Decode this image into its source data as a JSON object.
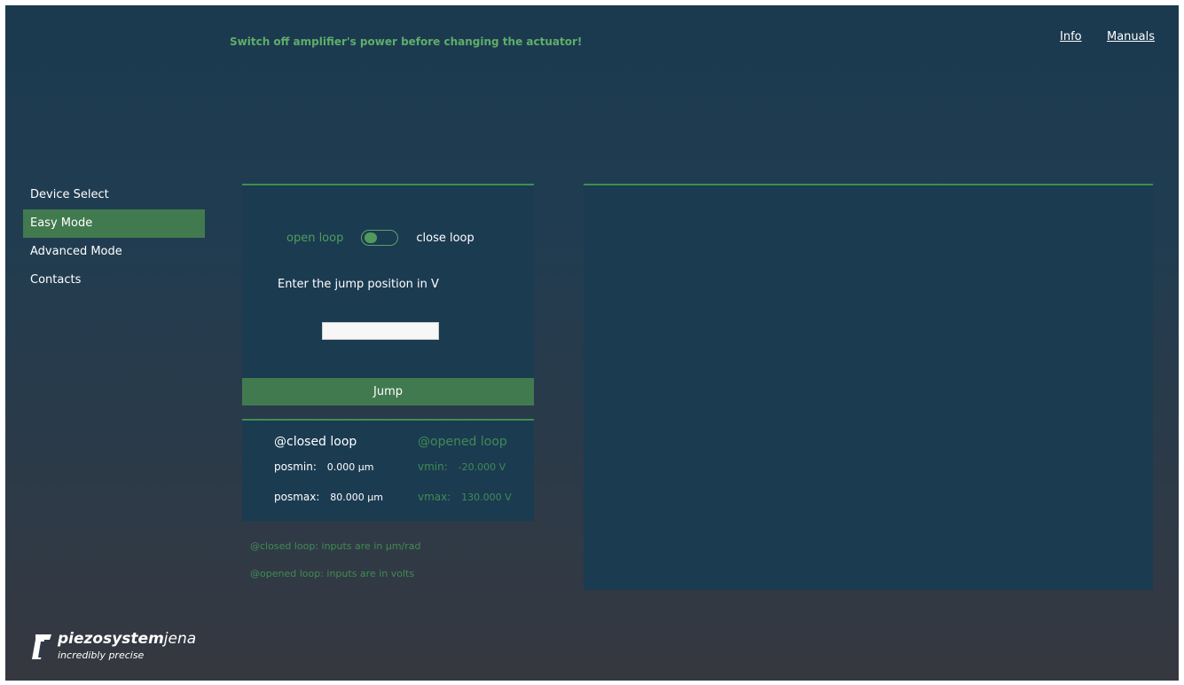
{
  "header": {
    "warning": "Switch off amplifier's power before changing the actuator!",
    "links": {
      "info": "Info",
      "manuals": "Manuals"
    }
  },
  "sidebar": {
    "items": [
      {
        "label": "Device Select"
      },
      {
        "label": "Easy Mode"
      },
      {
        "label": "Advanced Mode"
      },
      {
        "label": "Contacts"
      }
    ],
    "active": "Easy Mode"
  },
  "easy_mode": {
    "loop_toggle": {
      "left_label": "open loop",
      "right_label": "close loop",
      "state": "open loop"
    },
    "jump_prompt": "Enter the jump position in V",
    "jump_value": "",
    "jump_button": "Jump"
  },
  "limits": {
    "closed_header": "@closed loop",
    "opened_header": "@opened loop",
    "posmin": {
      "label": "posmin:",
      "value": "0.000 µm"
    },
    "posmax": {
      "label": "posmax:",
      "value": "80.000 µm"
    },
    "vmin": {
      "label": "vmin:",
      "value": "-20.000 V"
    },
    "vmax": {
      "label": "vmax:",
      "value": "130.000 V"
    }
  },
  "notes": {
    "closed": "@closed loop:  inputs are in µm/rad",
    "opened": "@opened loop:  inputs are in volts"
  },
  "logo": {
    "brand_bold": "piezosystem",
    "brand_light": "jena",
    "tagline": "incredibly precise"
  },
  "colors": {
    "accent_green": "#427a4f",
    "text_green": "#3f8c52",
    "panel": "#1b3b51"
  }
}
